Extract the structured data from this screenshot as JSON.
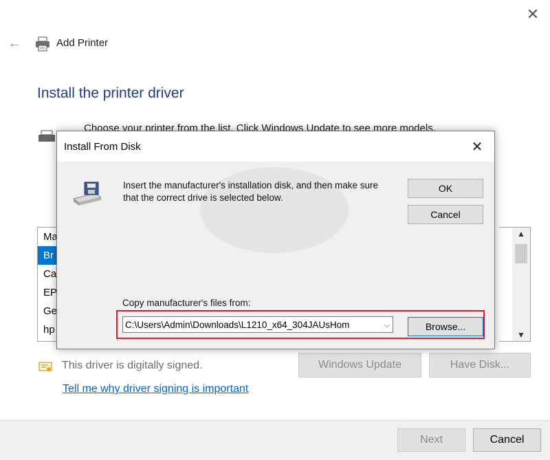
{
  "window": {
    "title": "Add Printer",
    "close_glyph": "✕",
    "back_glyph": "←"
  },
  "main": {
    "heading": "Install the printer driver",
    "instructions": "Choose your printer from the list. Click Windows Update to see more models.",
    "manufacturers": [
      "Ma",
      "Br",
      "Ca",
      "EP",
      "Ge",
      "hp"
    ],
    "selected_manufacturer_index": 1,
    "windows_update_label": "Windows Update",
    "have_disk_label": "Have Disk...",
    "signed_text": "This driver is digitally signed.",
    "signing_link": "Tell me why driver signing is important"
  },
  "footer": {
    "next_label": "Next",
    "cancel_label": "Cancel"
  },
  "dialog": {
    "title": "Install From Disk",
    "close_glyph": "✕",
    "message": "Insert the manufacturer's installation disk, and then make sure that the correct drive is selected below.",
    "ok_label": "OK",
    "cancel_label": "Cancel",
    "copy_from_label": "Copy manufacturer's files from:",
    "path_value": "C:\\Users\\Admin\\Downloads\\L1210_x64_304JAUsHom",
    "browse_label": "Browse..."
  },
  "icons": {
    "back": "back-arrow-icon",
    "close": "close-icon",
    "printer": "printer-icon",
    "disk": "disk-drive-icon",
    "shield": "signed-certificate-icon"
  },
  "colors": {
    "accent": "#0078d7",
    "heading": "#1f3d8c",
    "link": "#0066cc",
    "highlight_frame": "#e01e27",
    "selection": "#0078d7"
  }
}
